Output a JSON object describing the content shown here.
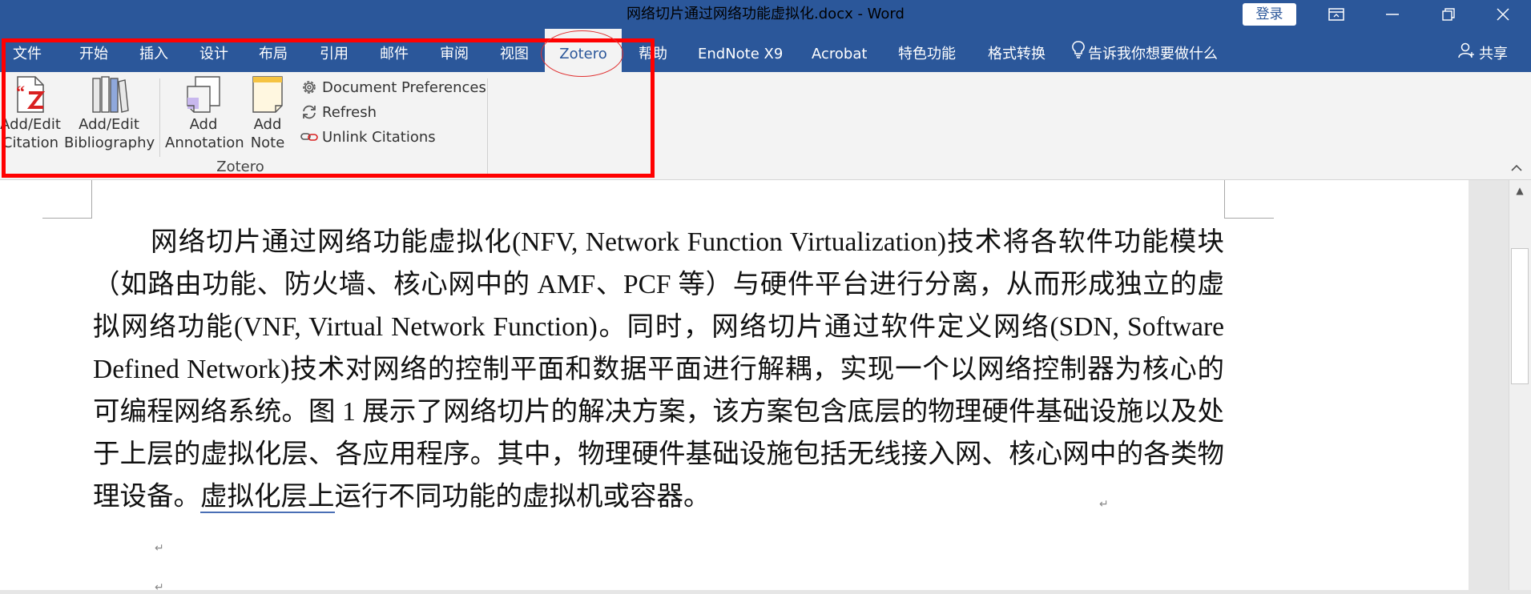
{
  "window": {
    "title": "网络切片通过网络功能虚拟化.docx  -  Word",
    "login_label": "登录",
    "controls": [
      "ribbon-display-icon",
      "minimize-icon",
      "restore-icon",
      "close-icon"
    ]
  },
  "quick_access": [
    "save-icon",
    "undo-icon",
    "undo-dropdown-icon",
    "redo-icon",
    "customize-qat-icon"
  ],
  "tabs": [
    {
      "label": "文件"
    },
    {
      "label": "开始"
    },
    {
      "label": "插入"
    },
    {
      "label": "设计"
    },
    {
      "label": "布局"
    },
    {
      "label": "引用"
    },
    {
      "label": "邮件"
    },
    {
      "label": "审阅"
    },
    {
      "label": "视图"
    },
    {
      "label": "Zotero",
      "active": true
    },
    {
      "label": "帮助"
    },
    {
      "label": "EndNote X9"
    },
    {
      "label": "Acrobat"
    },
    {
      "label": "特色功能"
    },
    {
      "label": "格式转换"
    }
  ],
  "tell_me": "告诉我你想要做什么",
  "share": "共享",
  "ribbon": {
    "large_buttons": [
      {
        "line1": "Add/Edit",
        "line2": "Citation"
      },
      {
        "line1": "Add/Edit",
        "line2": "Bibliography"
      },
      {
        "line1": "Add",
        "line2": "Annotation"
      },
      {
        "line1": "Add",
        "line2": "Note"
      }
    ],
    "small_buttons": [
      {
        "label": "Document Preferences"
      },
      {
        "label": "Refresh"
      },
      {
        "label": "Unlink Citations"
      }
    ],
    "group_label": "Zotero"
  },
  "document": {
    "p1": "网络切片通过网络功能虚拟化(NFV, Network Function Virtualization)技术将各软件功能模块（如路由功能、防火墙、核心网中的 AMF、PCF 等）与硬件平台进行分离，从而形成独立的虚拟网络功能(VNF, Virtual Network Function)。同时，网络切片通过软件定义网络(SDN, Software Defined Network)技术对网络的控制平面和数据平面进行解耦，实现一个以网络控制器为核心的可编程网络系统。图 1 展示了网络切片的解决方案，该方案包含底层的物理硬件基础设施以及处于上层的虚拟化层、各应用程序。其中，物理硬件基础设施包括无线接入网、核心网中的各类物理设备。",
    "p1_underlined": "虚拟化层上",
    "p1_tail": "运行不同功能的虚拟机或容器。",
    "paragraph_mark": "↵"
  },
  "colors": {
    "accent": "#2b579a",
    "ribbon_bg": "#f3f3f3",
    "highlight": "#ff0000",
    "zotero_red": "#d92121"
  }
}
